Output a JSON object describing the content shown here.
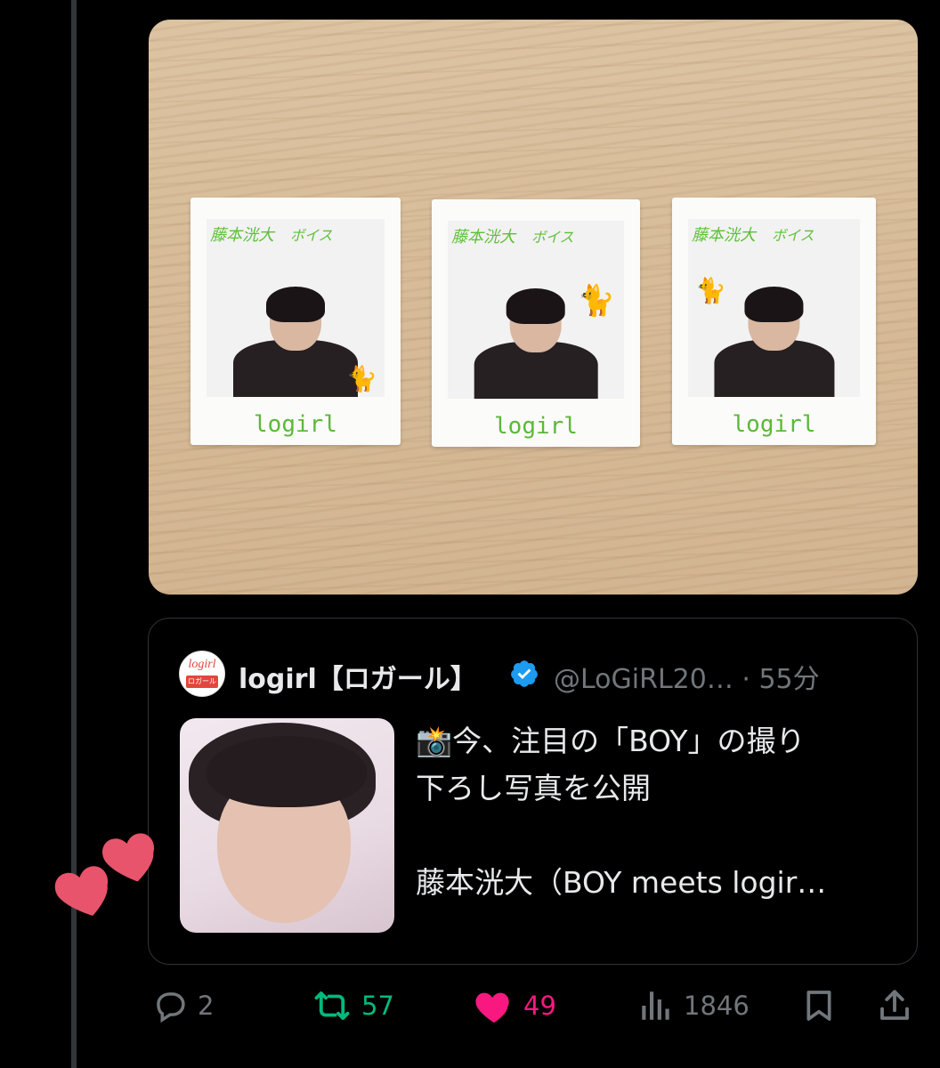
{
  "photo": {
    "polaroids": [
      {
        "caption": "logirl"
      },
      {
        "caption": "logirl"
      },
      {
        "caption": "logirl"
      }
    ]
  },
  "quote": {
    "avatar_text": "logirl",
    "avatar_subtext": "ロガール",
    "name": "logirl【ロガール】",
    "handle_time": "@LoGiRL20… · 55分",
    "text_lines": [
      "📸今、注目の「BOY」の撮り",
      "下ろし写真を公開",
      "",
      "藤本洸大（BOY meets logir…"
    ]
  },
  "actions": {
    "reply_count": "2",
    "retweet_count": "57",
    "like_count": "49",
    "views_count": "1846"
  },
  "colors": {
    "retweet": "#00ba7c",
    "like": "#f91880",
    "muted": "#71767b",
    "verified": "#1d9bf0"
  }
}
